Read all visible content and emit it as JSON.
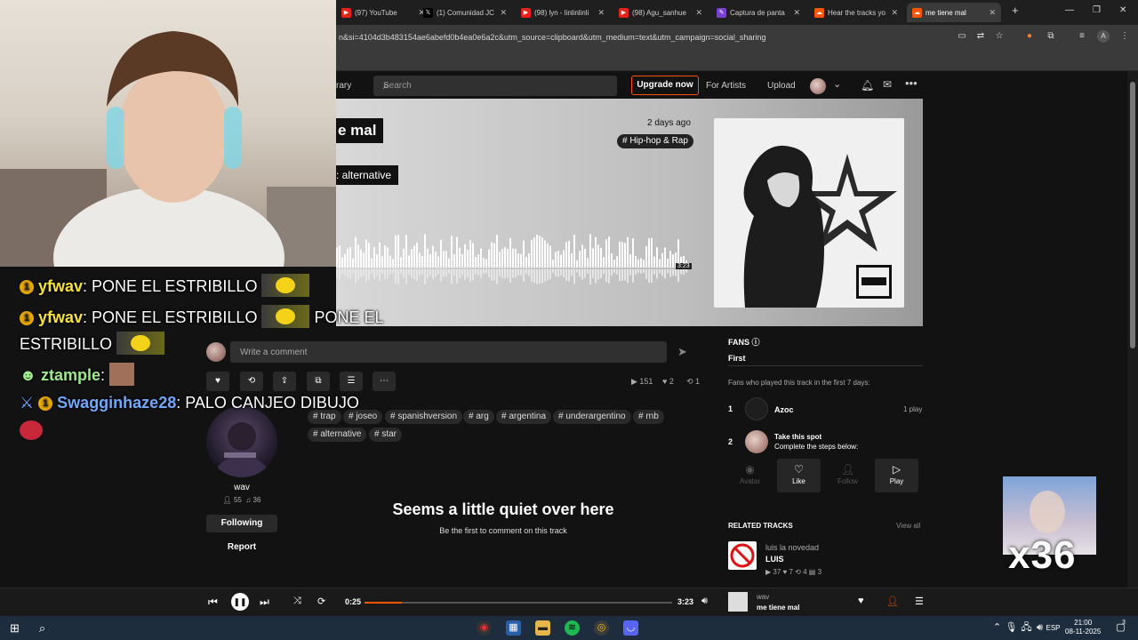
{
  "browser": {
    "tabs": [
      {
        "label": "(97) YouTube",
        "icon": "youtube-icon"
      },
      {
        "label": "(1) Comunidad JC",
        "icon": "x-icon"
      },
      {
        "label": "(98) lyn - linlinlinli",
        "icon": "youtube-icon"
      },
      {
        "label": "(98) Agu_sanhue",
        "icon": "youtube-icon"
      },
      {
        "label": "Captura de panta",
        "icon": "pen-icon"
      },
      {
        "label": "Hear the tracks yo",
        "icon": "soundcloud-icon"
      },
      {
        "label": "me tiene mal",
        "icon": "soundcloud-icon",
        "active": true
      }
    ],
    "new_tab": "+",
    "url": "n&si=4104d3b483154ae6abefd0b4ea0e6a2c&utm_source=clipboard&utm_medium=text&utm_campaign=social_sharing",
    "profile_initial": "A"
  },
  "nav": {
    "library_partial": "rary",
    "search_placeholder": "Search",
    "upgrade": "Upgrade now",
    "for_artists": "For Artists",
    "upload": "Upload"
  },
  "track": {
    "title_partial": "e mal",
    "genre_partial": ": alternative",
    "posted": "2 days ago",
    "genre_tag": "# Hip-hop & Rap",
    "duration_wave": "3:23",
    "artwork_label": "PARENTAL ADVISORY EXPLICIT CONTENT"
  },
  "comment": {
    "placeholder": "Write a comment"
  },
  "stats": {
    "plays": "151",
    "likes": "2",
    "reposts": "1"
  },
  "tags": [
    "# trap",
    "# joseo",
    "# spanishversion",
    "# arg",
    "# argentina",
    "# underargentino",
    "# rnb",
    "# alternative",
    "# star"
  ],
  "artist": {
    "name": "wav",
    "followers": "55",
    "tracks": "36",
    "following_label": "Following",
    "report_label": "Report"
  },
  "empty_comments": {
    "title": "Seems a little quiet over here",
    "subtitle": "Be the first to comment on this track"
  },
  "fans": {
    "title": "FANS",
    "tab": "First",
    "description": "Fans who played this track in the first 7 days:",
    "rows": [
      {
        "rank": "1",
        "name": "Azoc",
        "plays": "1 play"
      },
      {
        "rank": "2",
        "name": "Take this spot",
        "hint": "Complete the steps below:"
      }
    ],
    "steps": [
      "Avatar",
      "Like",
      "Follow",
      "Play"
    ]
  },
  "related": {
    "title": "RELATED TRACKS",
    "view_all": "View all",
    "items": [
      {
        "artist": "luis la novedad",
        "title": "LUIS",
        "plays": "37",
        "likes": "7",
        "reposts": "4",
        "comments": "3"
      }
    ]
  },
  "player": {
    "elapsed": "0:25",
    "total": "3:23",
    "progress_fraction": 0.12,
    "artist": "wav",
    "title": "me tiene mal"
  },
  "overlay": {
    "chat": [
      {
        "user": "yfwav",
        "message": ": PONE EL ESTRIBILLO",
        "color": "#f4e23a",
        "badge": "1"
      },
      {
        "user": "yfwav",
        "message": ": PONE EL ESTRIBILLO",
        "color": "#f4e23a",
        "badge": "1",
        "trail": "PONE EL"
      },
      {
        "user": "",
        "message": "ESTRIBILLO",
        "color": "#ffffff"
      },
      {
        "user": "ztample",
        "message": ":",
        "color": "#9fe88d"
      },
      {
        "user": "Swagginhaze28",
        "message": ": PALO CANJEO DIBUJO",
        "color": "#6fa8ff",
        "badge": "1"
      }
    ],
    "viewer_multiplier": "x36"
  },
  "taskbar": {
    "language": "ESP",
    "time": "21:00",
    "date": "08-11-2025",
    "notifications": "3"
  },
  "colors": {
    "accent": "#ff5500",
    "background": "#121212"
  }
}
